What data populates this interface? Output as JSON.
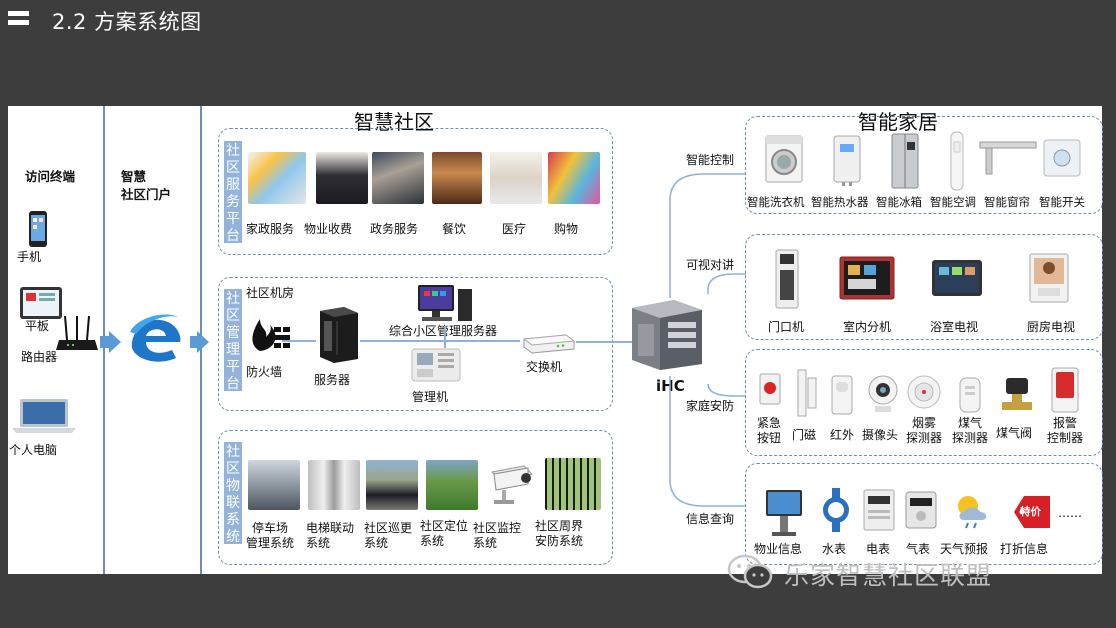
{
  "header": {
    "title": "2.2 方案系统图"
  },
  "columns": {
    "access": {
      "title": "访问终端",
      "devices": [
        "手机",
        "平板",
        "路由器",
        "个人电脑"
      ]
    },
    "portal": {
      "title_line1": "智慧",
      "title_line2": "社区门户"
    }
  },
  "community": {
    "title": "智慧社区",
    "service": {
      "tag": "社区服务平台",
      "items": [
        "家政服务",
        "物业收费",
        "政务服务",
        "餐饮",
        "医疗",
        "购物"
      ]
    },
    "management": {
      "tag": "社区管理平台",
      "room_label": "社区机房",
      "firewall": "防火墙",
      "server": "服务器",
      "complex_server": "综合小区管理服务器",
      "admin": "管理机",
      "switch": "交换机"
    },
    "iot": {
      "tag": "社区物联系统",
      "items": [
        [
          "停车场",
          "管理系统"
        ],
        [
          "电梯联动",
          "系统"
        ],
        [
          "社区巡更",
          "系统"
        ],
        [
          "社区定位",
          "系统"
        ],
        [
          "社区监控",
          "系统"
        ],
        [
          "社区周界",
          "安防系统"
        ]
      ]
    }
  },
  "hub": {
    "label": "iHC"
  },
  "smarthome": {
    "title": "智能家居",
    "control": {
      "label": "智能控制",
      "items": [
        "智能洗衣机",
        "智能热水器",
        "智能冰箱",
        "智能空调",
        "智能窗帘",
        "智能开关"
      ]
    },
    "intercom": {
      "label": "可视对讲",
      "items": [
        "门口机",
        "室内分机",
        "浴室电视",
        "厨房电视"
      ]
    },
    "security": {
      "label": "家庭安防",
      "items": [
        [
          "紧急",
          "按钮"
        ],
        [
          "门磁"
        ],
        [
          "红外"
        ],
        [
          "摄像头"
        ],
        [
          "烟雾",
          "探测器"
        ],
        [
          "煤气",
          "探测器"
        ],
        [
          "煤气阀"
        ],
        [
          "报警",
          "控制器"
        ]
      ]
    },
    "info": {
      "label": "信息查询",
      "items": [
        "物业信息",
        "水表",
        "电表",
        "气表",
        "天气预报",
        "打折信息"
      ],
      "more": "……",
      "discount_badge": "特价"
    }
  },
  "watermark": {
    "text": "乐家智慧社区联盟"
  },
  "colors": {
    "background": "#3d3d3d",
    "accent": "#5b9bd5",
    "tag": "#93b4d8",
    "box_border": "#6a8fb5"
  }
}
